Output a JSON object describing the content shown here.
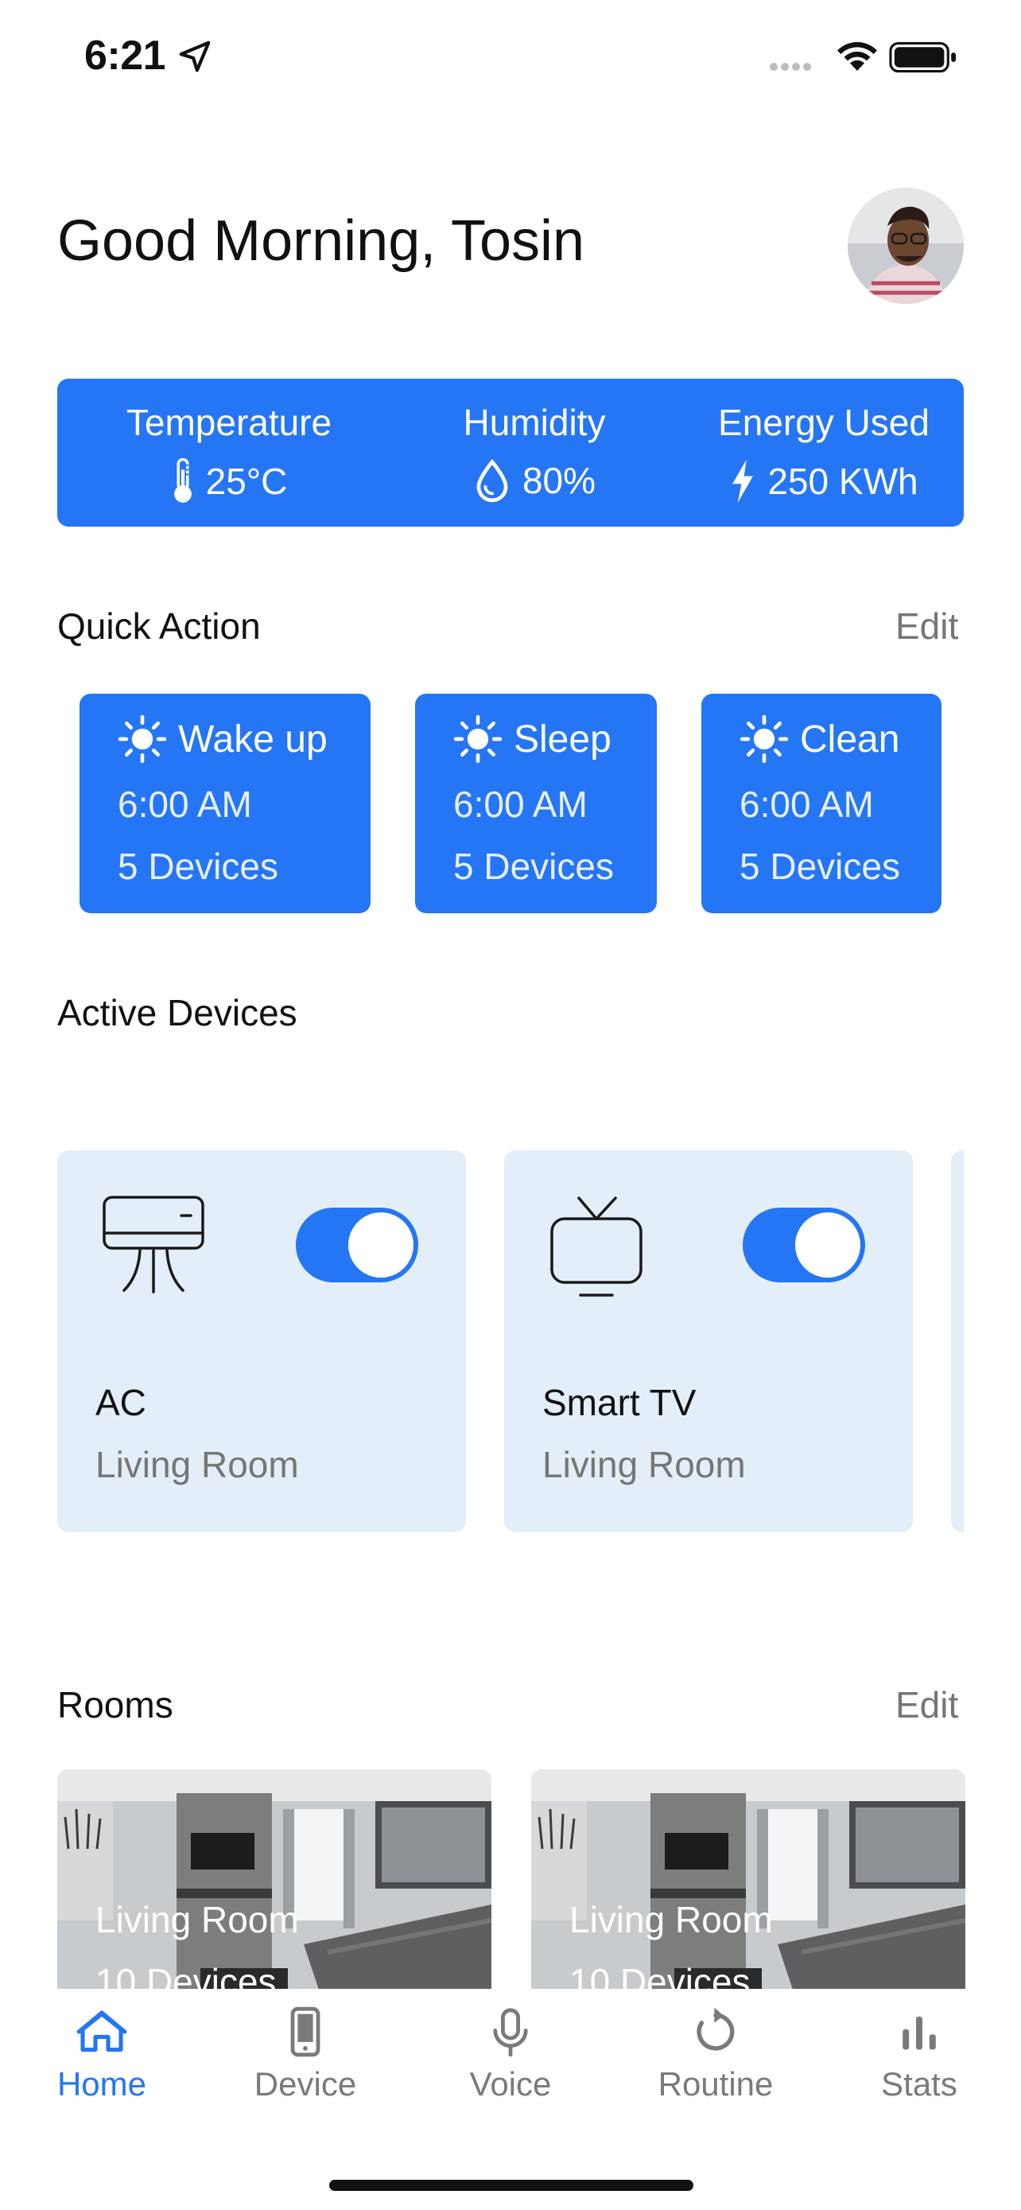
{
  "status_bar": {
    "time": "6:21"
  },
  "header": {
    "greeting": "Good Morning, Tosin"
  },
  "stats": {
    "temperature": {
      "label": "Temperature",
      "value": "25°C"
    },
    "humidity": {
      "label": "Humidity",
      "value": "80%"
    },
    "energy": {
      "label": "Energy Used",
      "value": "250 KWh"
    }
  },
  "quick_action": {
    "title": "Quick Action",
    "edit_label": "Edit",
    "items": [
      {
        "name": "Wake up",
        "time": "6:00 AM",
        "devices": "5 Devices"
      },
      {
        "name": "Sleep",
        "time": "6:00 AM",
        "devices": "5 Devices"
      },
      {
        "name": "Clean",
        "time": "6:00 AM",
        "devices": "5 Devices"
      }
    ]
  },
  "active_devices": {
    "title": "Active Devices",
    "items": [
      {
        "name": "AC",
        "room": "Living Room",
        "on": true,
        "icon": "air-conditioner-icon"
      },
      {
        "name": "Smart TV",
        "room": "Living Room",
        "on": true,
        "icon": "tv-icon"
      }
    ]
  },
  "rooms": {
    "title": "Rooms",
    "edit_label": "Edit",
    "items": [
      {
        "name": "Living Room",
        "devices": "10 Devices"
      },
      {
        "name": "Living Room",
        "devices": "10 Devices"
      }
    ]
  },
  "tabbar": {
    "items": [
      {
        "label": "Home",
        "icon": "home-icon",
        "active": true
      },
      {
        "label": "Device",
        "icon": "phone-icon",
        "active": false
      },
      {
        "label": "Voice",
        "icon": "microphone-icon",
        "active": false
      },
      {
        "label": "Routine",
        "icon": "refresh-icon",
        "active": false
      },
      {
        "label": "Stats",
        "icon": "bar-chart-icon",
        "active": false
      }
    ]
  },
  "colors": {
    "accent": "#2576f4",
    "card_light": "#e3eef8",
    "muted_text": "#767676"
  }
}
